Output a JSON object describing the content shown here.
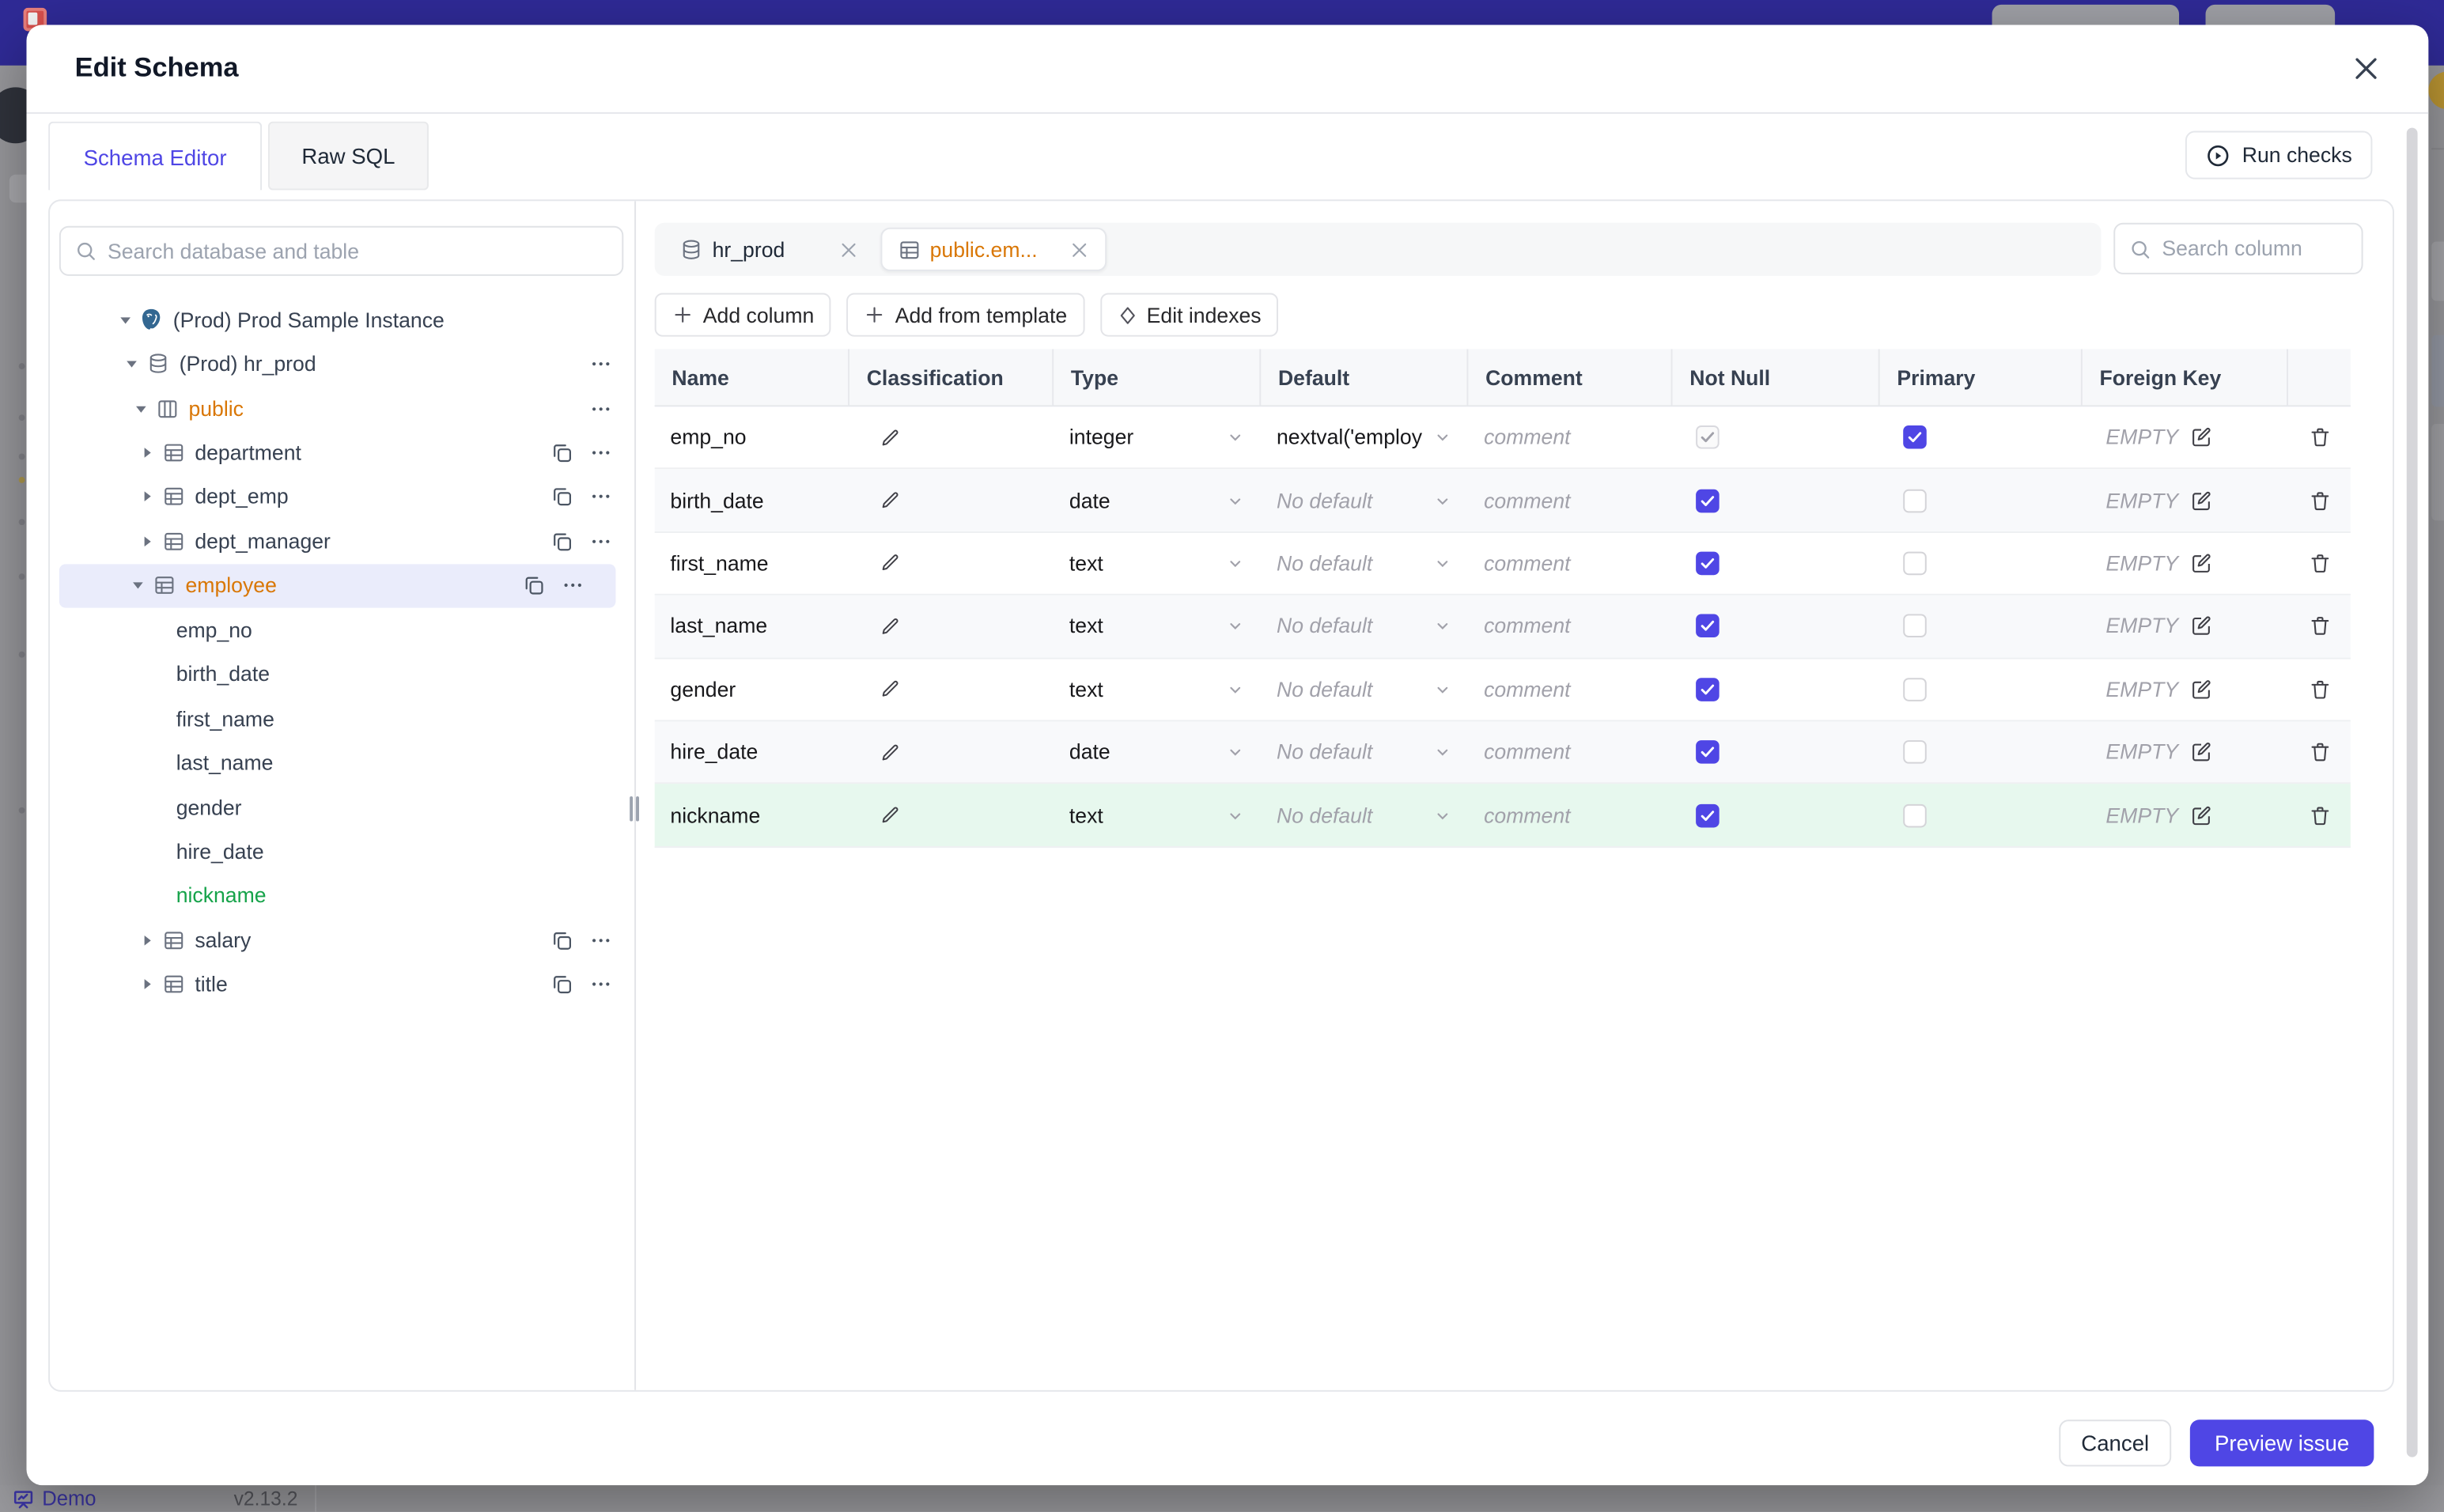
{
  "modal": {
    "title": "Edit Schema",
    "tabs": [
      {
        "label": "Schema Editor",
        "active": true
      },
      {
        "label": "Raw SQL",
        "active": false
      }
    ],
    "run_checks_label": "Run checks",
    "sidebar": {
      "search_placeholder": "Search database and table",
      "tree": [
        {
          "label": "(Prod) Prod Sample Instance",
          "depth": 0,
          "icon": "postgres-icon",
          "expand": "open"
        },
        {
          "label": "(Prod) hr_prod",
          "depth": 1,
          "icon": "database-icon",
          "expand": "open",
          "more": true
        },
        {
          "label": "public",
          "depth": 2,
          "icon": "schema-icon",
          "expand": "open",
          "more": true,
          "color": "amber"
        },
        {
          "label": "department",
          "depth": 3,
          "icon": "table-icon",
          "expand": "closed",
          "copy": true,
          "more": true
        },
        {
          "label": "dept_emp",
          "depth": 3,
          "icon": "table-icon",
          "expand": "closed",
          "copy": true,
          "more": true
        },
        {
          "label": "dept_manager",
          "depth": 3,
          "icon": "table-icon",
          "expand": "closed",
          "copy": true,
          "more": true
        },
        {
          "label": "employee",
          "depth": 3,
          "icon": "table-icon",
          "expand": "open",
          "copy": true,
          "more": true,
          "color": "amber",
          "selected": true
        },
        {
          "label": "emp_no",
          "depth": 4
        },
        {
          "label": "birth_date",
          "depth": 4
        },
        {
          "label": "first_name",
          "depth": 4
        },
        {
          "label": "last_name",
          "depth": 4
        },
        {
          "label": "gender",
          "depth": 4
        },
        {
          "label": "hire_date",
          "depth": 4
        },
        {
          "label": "nickname",
          "depth": 4,
          "color": "green"
        },
        {
          "label": "salary",
          "depth": 3,
          "icon": "table-icon",
          "expand": "closed",
          "copy": true,
          "more": true
        },
        {
          "label": "title",
          "depth": 3,
          "icon": "table-icon",
          "expand": "closed",
          "copy": true,
          "more": true
        }
      ]
    },
    "editor": {
      "chips": [
        {
          "label": "hr_prod",
          "icon": "database-icon",
          "active": false
        },
        {
          "label": "public.em...",
          "icon": "table-icon",
          "active": true,
          "color": "amber"
        }
      ],
      "column_search_placeholder": "Search column",
      "toolbar": [
        {
          "label": "Add column",
          "icon": "plus-icon"
        },
        {
          "label": "Add from template",
          "icon": "plus-icon"
        },
        {
          "label": "Edit indexes",
          "icon": "diamond-icon"
        }
      ],
      "grid": {
        "columns": [
          "Name",
          "Classification",
          "Type",
          "Default",
          "Comment",
          "Not Null",
          "Primary",
          "Foreign Key",
          ""
        ],
        "comment_placeholder": "comment",
        "no_default_placeholder": "No default",
        "foreign_key_value": "EMPTY",
        "rows": [
          {
            "name": "emp_no",
            "type": "integer",
            "default": "nextval('employ",
            "not_null": "disabled-checked",
            "primary": "checked",
            "shade": false
          },
          {
            "name": "birth_date",
            "type": "date",
            "default": null,
            "not_null": "checked",
            "primary": "unchecked",
            "shade": true
          },
          {
            "name": "first_name",
            "type": "text",
            "default": null,
            "not_null": "checked",
            "primary": "unchecked",
            "shade": false
          },
          {
            "name": "last_name",
            "type": "text",
            "default": null,
            "not_null": "checked",
            "primary": "unchecked",
            "shade": true
          },
          {
            "name": "gender",
            "type": "text",
            "default": null,
            "not_null": "checked",
            "primary": "unchecked",
            "shade": false
          },
          {
            "name": "hire_date",
            "type": "date",
            "default": null,
            "not_null": "checked",
            "primary": "unchecked",
            "shade": true
          },
          {
            "name": "nickname",
            "type": "text",
            "default": null,
            "not_null": "checked",
            "primary": "unchecked",
            "shade": false,
            "highlight": "green"
          }
        ]
      }
    },
    "footer": {
      "cancel_label": "Cancel",
      "submit_label": "Preview issue"
    }
  },
  "page_footer": {
    "demo_label": "Demo",
    "version": "v2.13.2"
  },
  "colors": {
    "accent": "#4f46e5",
    "amber": "#d97706",
    "green": "#16a34a",
    "banner": "#2f2a96",
    "green_row_bg": "#e7f8ee",
    "selected_row_bg": "#eaecfb"
  }
}
